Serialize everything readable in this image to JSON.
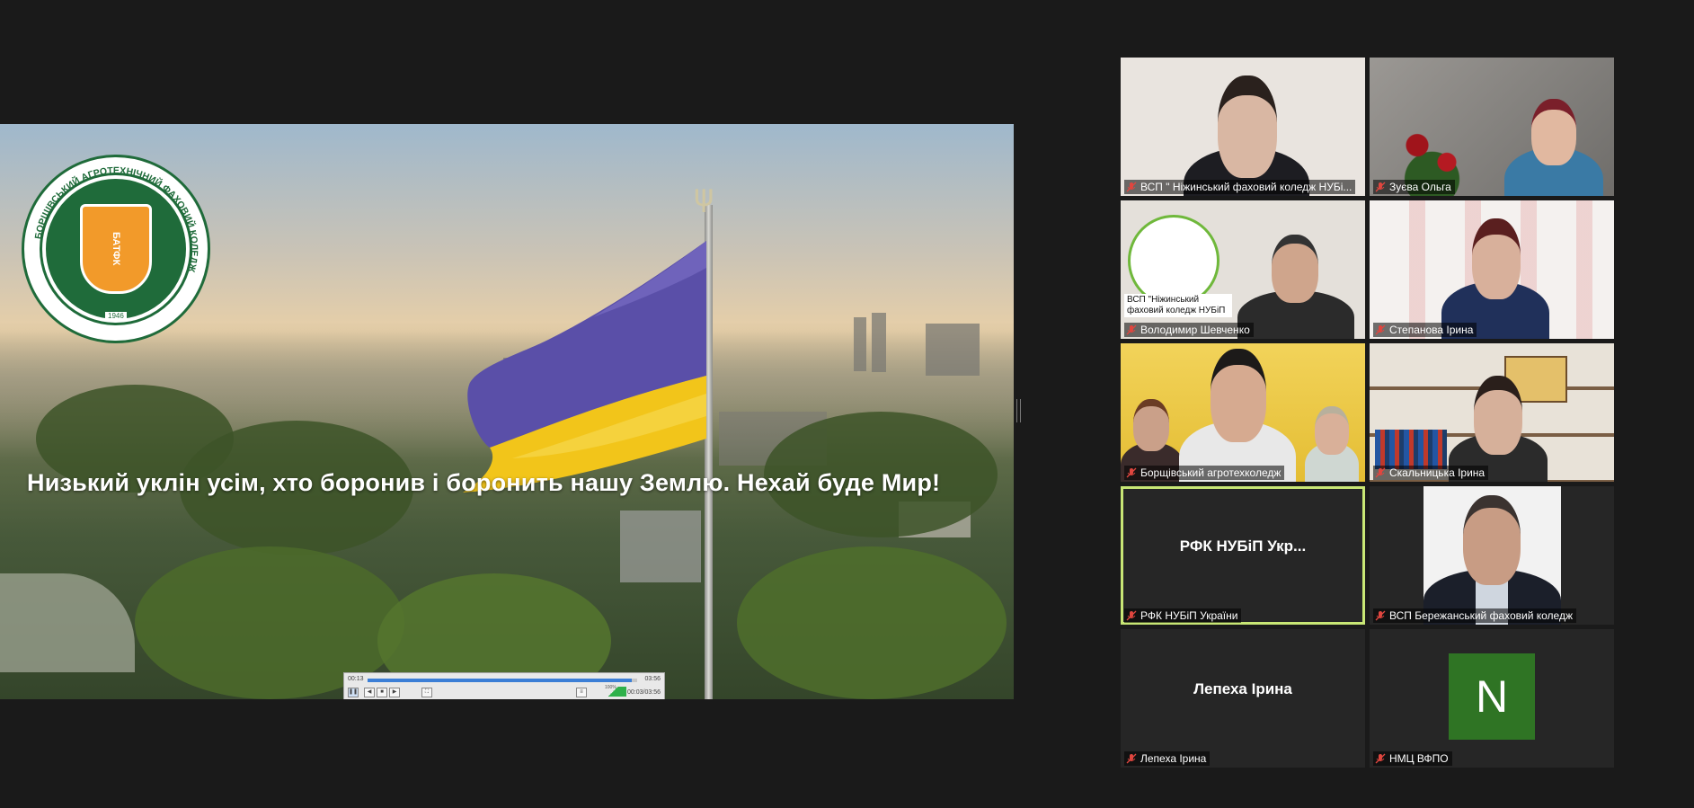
{
  "shared_screen": {
    "caption": "Низький уклін усім, хто  боронив і боронить нашу Землю. Нехай буде Мир!",
    "logo": {
      "ring_text": "БОРЩІВСЬКИЙ АГРОТЕХНІЧНИЙ ФАХОВИЙ КОЛЕДЖ",
      "shield_text": "БАТФК",
      "year": "1946"
    },
    "player": {
      "elapsed": "00:13",
      "duration": "03:56",
      "time_detail": "00:03/03:56",
      "progress": 0.98,
      "volume_label": "100%"
    }
  },
  "participants": [
    {
      "label": "ВСП \" Ніжинський фаховий коледж НУБі...",
      "kind": "video"
    },
    {
      "label": "Зуєва Ольга",
      "kind": "video"
    },
    {
      "label": "Володимир Шевченко",
      "kind": "video",
      "overlay_text": "ВСП \"Ніжинський фаховий коледж НУБіП"
    },
    {
      "label": "Степанова Ірина",
      "kind": "video"
    },
    {
      "label": "Борщівський агротехколедж",
      "kind": "video"
    },
    {
      "label": "Скальницька Ірина",
      "kind": "video"
    },
    {
      "label": "РФК НУБіП України",
      "kind": "name",
      "display_name": "РФК НУБіП Укр...",
      "active": true
    },
    {
      "label": "ВСП Бережанський фаховий коледж",
      "kind": "video"
    },
    {
      "label": "Лепеха Ірина",
      "kind": "name",
      "display_name": "Лепеха Ірина"
    },
    {
      "label": "НМЦ ВФПО",
      "kind": "avatar",
      "avatar_letter": "N",
      "avatar_color": "#2f7424"
    }
  ],
  "colors": {
    "background": "#1a1a1a",
    "active_speaker_border": "#c8e675",
    "muted_mic": "#e0463f"
  },
  "icons": {
    "muted": "muted-mic-icon"
  }
}
